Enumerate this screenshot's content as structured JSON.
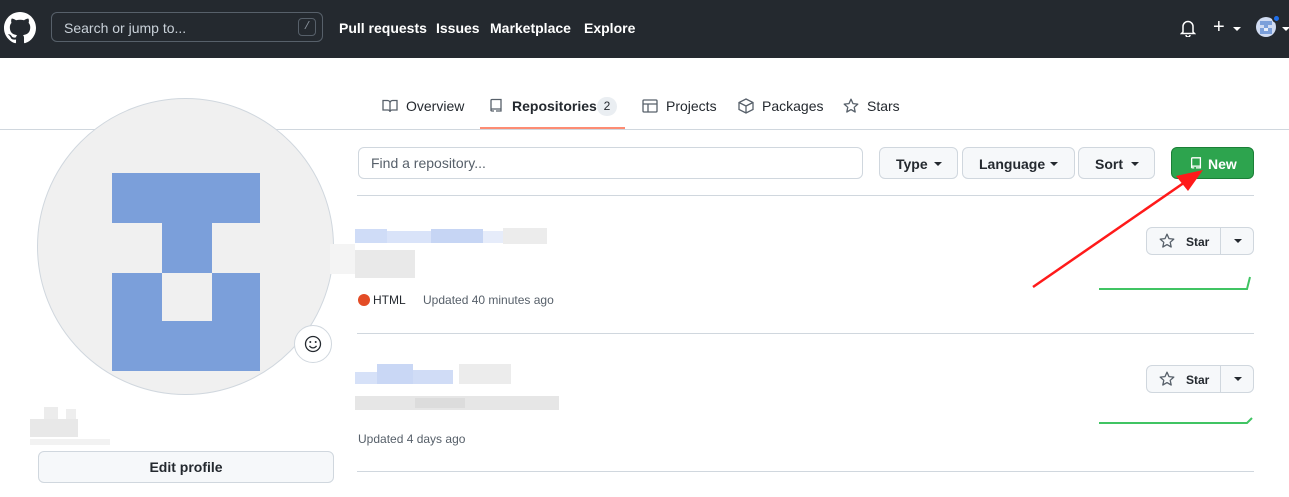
{
  "header": {
    "search_placeholder": "Search or jump to...",
    "search_shortcut": "/",
    "nav": [
      "Pull requests",
      "Issues",
      "Marketplace",
      "Explore"
    ],
    "plus_label": "+"
  },
  "tabs": [
    {
      "label": "Overview",
      "icon": "book-icon"
    },
    {
      "label": "Repositories",
      "icon": "repo-icon",
      "count": "2",
      "active": true
    },
    {
      "label": "Projects",
      "icon": "table-icon"
    },
    {
      "label": "Packages",
      "icon": "package-icon"
    },
    {
      "label": "Stars",
      "icon": "star-icon"
    }
  ],
  "profile": {
    "edit_label": "Edit profile",
    "avatar_color": "#7b9fda"
  },
  "repo_toolbar": {
    "find_placeholder": "Find a repository...",
    "type_label": "Type",
    "language_label": "Language",
    "sort_label": "Sort",
    "new_label": "New",
    "new_color": "#2da44e"
  },
  "repos": [
    {
      "language": "HTML",
      "language_color": "#e34c26",
      "updated": "Updated 40 minutes ago",
      "star_label": "Star"
    },
    {
      "updated": "Updated 4 days ago",
      "star_label": "Star"
    }
  ]
}
